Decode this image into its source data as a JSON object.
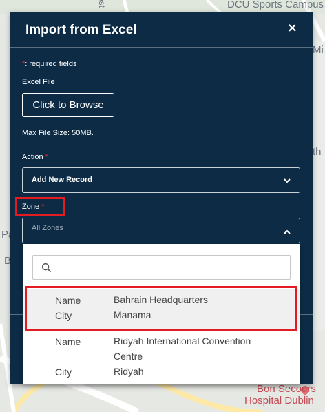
{
  "map": {
    "labels": {
      "campus": "DCU Sports Campus",
      "right_1": "Mi",
      "right_2": "th",
      "left_1": "Pa",
      "left_2": "B",
      "street": "est"
    },
    "poi": {
      "line1": "Bon Secours",
      "line2": "Hospital Dublin"
    }
  },
  "modal": {
    "title": "Import from Excel",
    "close_label": "×",
    "required_star": "*",
    "required_note": ": required fields",
    "excel_file_label": "Excel File",
    "browse_label": "Click to Browse",
    "max_file_size": "Max File Size: 50MB.",
    "action": {
      "label": "Action",
      "star": "*",
      "value": "Add New Record"
    },
    "zone": {
      "label": "Zone",
      "star": "*",
      "value": "All Zones"
    }
  },
  "dropdown": {
    "search_value": "",
    "options": [
      {
        "name_key": "Name",
        "name_value": "Bahrain Headquarters",
        "city_key": "City",
        "city_value": "Manama",
        "selected": true
      },
      {
        "name_key": "Name",
        "name_value_line1": "Ridyah International Convention",
        "name_value_line2": "Centre",
        "city_key": "City",
        "city_value": "Ridyah",
        "selected": false
      }
    ]
  },
  "colors": {
    "modal_bg": "#0d2b45",
    "highlight": "#e31b23",
    "required": "#e2283b",
    "selected_option_bg": "#f0f0f0"
  }
}
